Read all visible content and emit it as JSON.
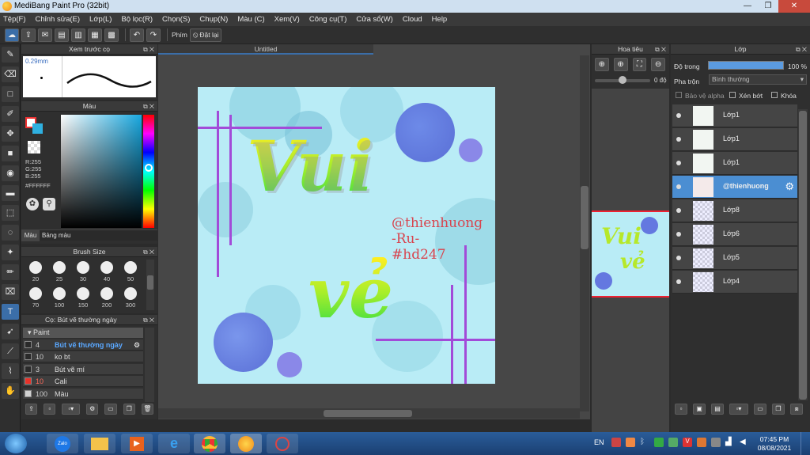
{
  "app": {
    "title": "MediBang Paint Pro (32bit)"
  },
  "menu": [
    "Tệp(F)",
    "Chỉnh sửa(E)",
    "Lớp(L)",
    "Bộ lọc(R)",
    "Chọn(S)",
    "Chụp(N)",
    "Màu (C)",
    "Xem(V)",
    "Công cụ(T)",
    "Cửa sổ(W)",
    "Cloud",
    "Help"
  ],
  "toolbar": {
    "snap_label": "Phím",
    "reset_label": "Đặt lại"
  },
  "brush_preview": {
    "title": "Xem trước cọ",
    "size": "0.29mm"
  },
  "color_panel": {
    "title": "Màu",
    "r": "R:255",
    "g": "G:255",
    "b": "B:255",
    "hex": "#FFFFFF",
    "tab_color": "Màu",
    "tab_palette": "Bảng màu"
  },
  "brush_size": {
    "title": "Brush Size",
    "sizes": [
      "20",
      "25",
      "30",
      "40",
      "50",
      "70",
      "100",
      "150",
      "200",
      "300"
    ]
  },
  "brush_list": {
    "title": "Cọ: Bút vẽ thường ngày",
    "group": "Paint",
    "items": [
      {
        "size": "4",
        "name": "Bút vẽ thường ngày",
        "color": "#2a2a2a"
      },
      {
        "size": "10",
        "name": "ko bt",
        "color": "#2a2a2a"
      },
      {
        "size": "3",
        "name": "Bút vẽ mí",
        "color": "#2a2a2a"
      },
      {
        "size": "10",
        "name": "Cali",
        "color": "#e8322a"
      },
      {
        "size": "100",
        "name": "Màu",
        "color": "#d0d0d0"
      }
    ]
  },
  "canvas": {
    "tab": "Untitled",
    "art": {
      "line1": "Vui",
      "line2": "vẻ",
      "signature": [
        "@thienhuong",
        "-Ru-",
        "#hd247"
      ]
    }
  },
  "navigator": {
    "title": "Hoa tiêu",
    "angle": "0 độ"
  },
  "layers": {
    "title": "Lớp",
    "opacity_label": "Độ trong",
    "opacity_value": "100 %",
    "blend_label": "Pha trộn",
    "blend_value": "Bình thường",
    "protect_alpha": "Bảo vệ alpha",
    "clip": "Xén bớt",
    "lock": "Khóa",
    "items": [
      {
        "name": "Lớp1",
        "selected": false
      },
      {
        "name": "Lớp1",
        "selected": false
      },
      {
        "name": "Lớp1",
        "selected": false
      },
      {
        "name": "@thienhuong",
        "selected": true
      },
      {
        "name": "Lớp8",
        "selected": false
      },
      {
        "name": "Lớp6",
        "selected": false
      },
      {
        "name": "Lớp5",
        "selected": false
      },
      {
        "name": "Lớp4",
        "selected": false
      }
    ]
  },
  "taskbar": {
    "lang": "EN",
    "time": "07:45 PM",
    "date": "08/08/2021",
    "zalo": "Zalo"
  }
}
